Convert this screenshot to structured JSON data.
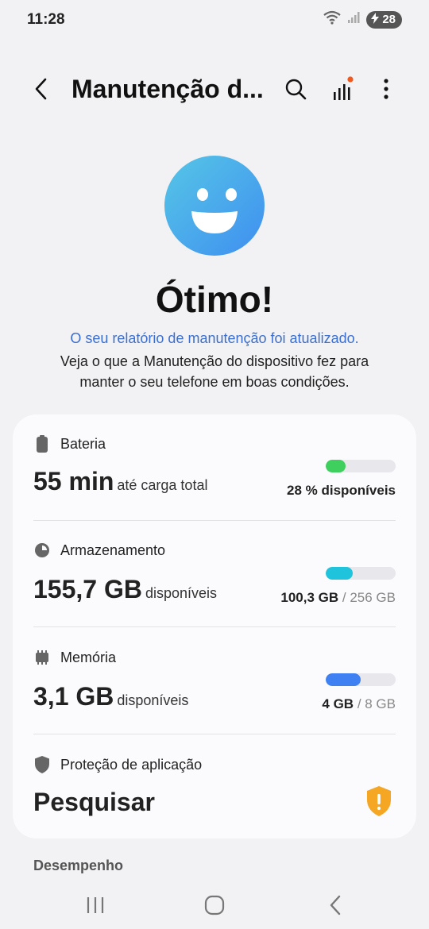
{
  "status_bar": {
    "time": "11:28",
    "battery_level": "28"
  },
  "app_bar": {
    "title": "Manutenção d..."
  },
  "status": {
    "headline": "Ótimo!",
    "report_link": "O seu relatório de manutenção foi atualizado.",
    "description": "Veja o que a Manutenção do dispositivo fez para manter o seu telefone em boas condições."
  },
  "battery": {
    "label": "Bateria",
    "value": "55 min",
    "unit": "até carga total",
    "status_text": "28 % disponíveis",
    "level": 0.28,
    "color": "#3ecf5e"
  },
  "storage": {
    "label": "Armazenamento",
    "value": "155,7 GB",
    "unit": "disponíveis",
    "used": "100,3 GB",
    "total": "/ 256 GB",
    "level": 0.39,
    "color": "#1fc3dc"
  },
  "memory": {
    "label": "Memória",
    "value": "3,1 GB",
    "unit": "disponíveis",
    "used": "4 GB",
    "total": "/ 8 GB",
    "level": 0.5,
    "color": "#3f80f2"
  },
  "app_protection": {
    "label": "Proteção de aplicação",
    "value": "Pesquisar",
    "warning_color": "#f5a623"
  },
  "performance": {
    "label": "Desempenho"
  },
  "colors": {
    "accent": "#3a6fd1",
    "background": "#f2f2f4",
    "card": "#fbfbfd"
  }
}
